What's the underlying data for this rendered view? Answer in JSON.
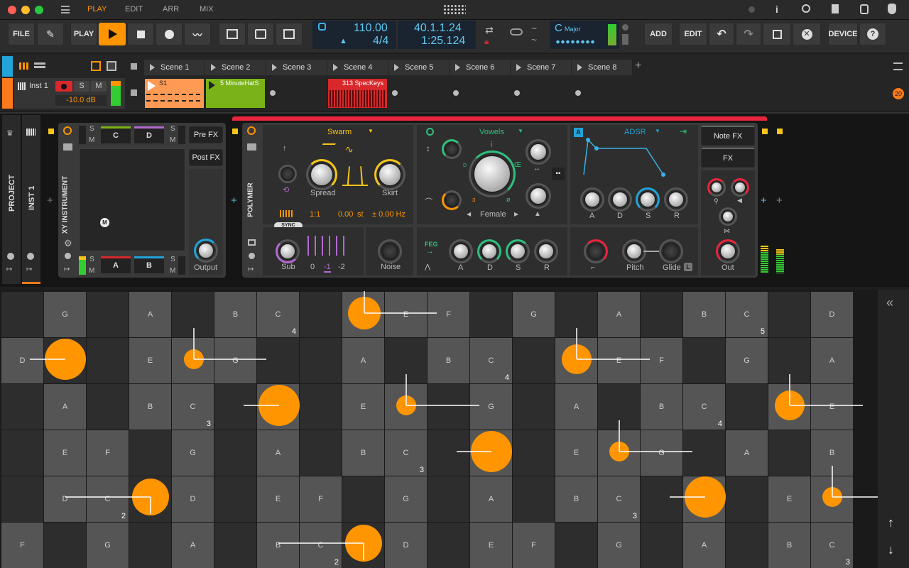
{
  "menu": {
    "tabs": [
      "PLAY",
      "EDIT",
      "ARR",
      "MIX"
    ],
    "active": "PLAY"
  },
  "toolbar": {
    "file": "FILE",
    "play": "PLAY",
    "add": "ADD",
    "edit": "EDIT",
    "device": "DEVICE"
  },
  "transport": {
    "tempo": "110.00",
    "signature": "4/4",
    "position": "40.1.1.24",
    "time": "1:25.124",
    "key": "C",
    "scale": "Major"
  },
  "track": {
    "name": "Inst 1",
    "volume": "-10.0 dB",
    "s": "S",
    "m": "M"
  },
  "scenes": [
    "Scene 1",
    "Scene 2",
    "Scene 3",
    "Scene 4",
    "Scene 5",
    "Scene 6",
    "Scene 7",
    "Scene 8"
  ],
  "clips": {
    "c1": "S1",
    "c2": "5 MinuteHatS",
    "c3": "313 SpecKeys"
  },
  "badge": "20",
  "side": {
    "project": "PROJECT",
    "inst": "INST 1"
  },
  "xy": {
    "title": "XY INSTRUMENT",
    "a": "A",
    "b": "B",
    "c": "C",
    "d": "D",
    "pre": "Pre FX",
    "post": "Post FX",
    "output": "Output",
    "m": "M",
    "s": "S"
  },
  "poly": {
    "title": "POLYMER",
    "osc": "Swarm",
    "filter": "Vowels",
    "env": "ADSR",
    "spread": "Spread",
    "skirt": "Skirt",
    "ratio": "1:1",
    "st": "0.00",
    "st_unit": "st",
    "hz": "± 0.00 Hz",
    "sync": "SYNC",
    "female": "Female",
    "sub": "Sub",
    "noise": "Noise",
    "feg": "FEG",
    "a": "A",
    "d": "D",
    "s": "S",
    "r": "R",
    "pitch": "Pitch",
    "glide": "Glide",
    "out": "Out",
    "notefx": "Note FX",
    "fx": "FX",
    "oct": [
      "0",
      "-1",
      "-2"
    ],
    "vowel": {
      "i": "i",
      "e": "Œ",
      "o": "ø",
      "u": "D",
      "a": "ɔ"
    },
    "l": "L"
  },
  "grid": [
    [
      "",
      "G",
      "",
      "A",
      "",
      "B",
      "C4",
      "",
      "D",
      "E",
      "F",
      "",
      "G",
      "",
      "A",
      "",
      "B",
      "C5",
      "",
      "D"
    ],
    [
      "D",
      "",
      "",
      "E",
      "F",
      "G",
      "",
      "",
      "A",
      "",
      "B",
      "C4",
      "",
      "D",
      "E",
      "F",
      "",
      "G",
      "",
      "A"
    ],
    [
      "",
      "A",
      "",
      "B",
      "C3",
      "",
      "D",
      "",
      "E",
      "F",
      "",
      "G",
      "",
      "A",
      "",
      "B",
      "C4",
      "",
      "D",
      "E"
    ],
    [
      "",
      "E",
      "F",
      "",
      "G",
      "",
      "A",
      "",
      "B",
      "C3",
      "",
      "D",
      "",
      "E",
      "F",
      "G",
      "",
      "A",
      "",
      "B"
    ],
    [
      "",
      "D",
      "C2",
      "",
      "D",
      "",
      "E",
      "F",
      "",
      "G",
      "",
      "A",
      "",
      "B",
      "C3",
      "",
      "D",
      "",
      "E",
      "F"
    ],
    [
      "F",
      "",
      "G",
      "",
      "A",
      "",
      "B",
      "C2",
      "",
      "D",
      "",
      "E",
      "F",
      "",
      "G",
      "",
      "A",
      "",
      "B",
      "C3"
    ]
  ],
  "colors": {
    "accent": "#ff9500",
    "clip2": "#7ab317",
    "clip3": "#d8282c",
    "blue": "#22a4d8"
  }
}
